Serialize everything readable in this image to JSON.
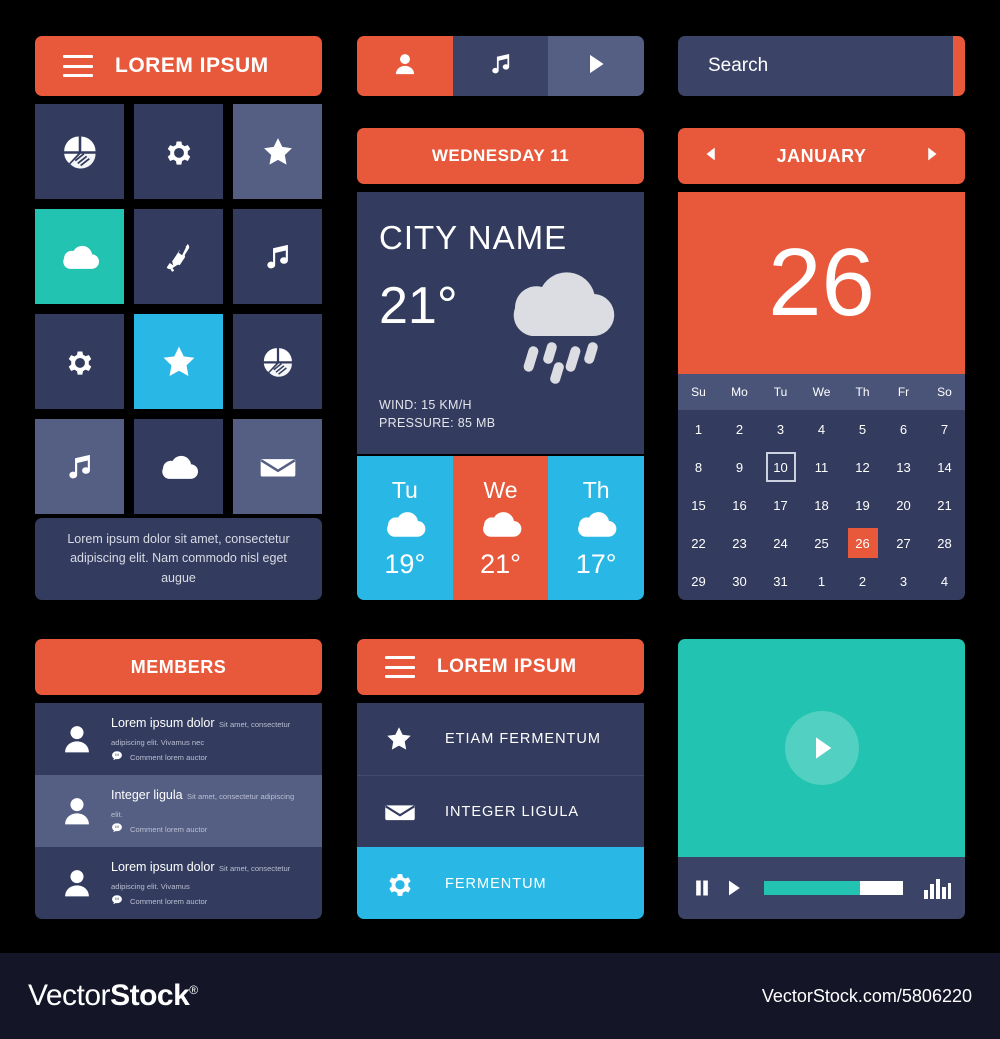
{
  "colors": {
    "background": "#000000",
    "orange": "#e8583a",
    "navy_dark": "#333c5e",
    "navy_mid": "#3b4467",
    "navy_light": "#555f83",
    "teal": "#22c3b0",
    "cyan": "#29b8e5",
    "footer_bg": "#141527",
    "text_white": "#ffffff"
  },
  "app_menu": {
    "header": {
      "title": "LOREM IPSUM",
      "menu_icon": "hamburger-icon"
    },
    "tiles": [
      {
        "icon": "pie-chart-icon",
        "style": "dark"
      },
      {
        "icon": "gear-icon",
        "style": "dark"
      },
      {
        "icon": "star-icon",
        "style": "light"
      },
      {
        "icon": "cloud-icon",
        "style": "teal"
      },
      {
        "icon": "phone-icon",
        "style": "dark"
      },
      {
        "icon": "music-note-icon",
        "style": "dark"
      },
      {
        "icon": "gear-icon",
        "style": "dark"
      },
      {
        "icon": "star-icon",
        "style": "cyan"
      },
      {
        "icon": "pie-chart-icon",
        "style": "dark"
      },
      {
        "icon": "music-note-icon",
        "style": "light"
      },
      {
        "icon": "cloud-icon",
        "style": "dark"
      },
      {
        "icon": "envelope-icon",
        "style": "light"
      }
    ],
    "blurb": "Lorem ipsum dolor sit amet, consectetur adipiscing elit. Nam commodo nisl eget augue"
  },
  "members": {
    "header": "MEMBERS",
    "rows": [
      {
        "avatar": "user-icon",
        "name": "Lorem ipsum dolor",
        "desc": "Sit amet, consectetur adipiscing elit. Vivamus nec",
        "comment_icon": "comment-icon",
        "comment": "Comment lorem auctor",
        "style": "odd"
      },
      {
        "avatar": "user-icon",
        "name": "Integer ligula",
        "desc": "Sit amet, consectetur adipiscing elit.",
        "comment_icon": "comment-icon",
        "comment": "Comment lorem auctor",
        "style": "even"
      },
      {
        "avatar": "user-icon",
        "name": "Lorem ipsum dolor",
        "desc": "Sit amet, consectetur adipiscing elit. Vivamus",
        "comment_icon": "comment-icon",
        "comment": "Comment lorem auctor",
        "style": "odd"
      }
    ]
  },
  "tabbar": {
    "tabs": [
      {
        "icon": "user-icon",
        "state": "active"
      },
      {
        "icon": "music-note-icon",
        "state": "normal"
      },
      {
        "icon": "play-icon",
        "state": "alt"
      }
    ]
  },
  "weather": {
    "header": "WEDNESDAY 11",
    "city": "CITY NAME",
    "temperature": "21°",
    "condition_icon": "rain-cloud-icon",
    "wind": "WIND: 15 KM/H",
    "pressure": "PRESSURE: 85 MB",
    "forecast": [
      {
        "day": "Tu",
        "icon": "cloud-icon",
        "temp": "19°",
        "style": "cyan"
      },
      {
        "day": "We",
        "icon": "cloud-icon",
        "temp": "21°",
        "style": "orange"
      },
      {
        "day": "Th",
        "icon": "cloud-icon",
        "temp": "17°",
        "style": "cyan"
      }
    ]
  },
  "menu_list": {
    "header": {
      "title": "LOREM IPSUM",
      "menu_icon": "hamburger-icon"
    },
    "items": [
      {
        "icon": "star-icon",
        "label": "ETIAM FERMENTUM",
        "selected": false
      },
      {
        "icon": "envelope-icon",
        "label": "INTEGER LIGULA",
        "selected": false
      },
      {
        "icon": "gear-icon",
        "label": "FERMENTUM",
        "selected": true
      }
    ]
  },
  "search": {
    "value": "Search",
    "placeholder": "Search",
    "button_icon": "search-icon"
  },
  "calendar": {
    "month": "JANUARY",
    "prev_icon": "chevron-left-icon",
    "next_icon": "chevron-right-icon",
    "selected_big": "26",
    "dow": [
      "Su",
      "Mo",
      "Tu",
      "We",
      "Th",
      "Fr",
      "So"
    ],
    "days": [
      {
        "n": "1"
      },
      {
        "n": "2"
      },
      {
        "n": "3"
      },
      {
        "n": "4"
      },
      {
        "n": "5"
      },
      {
        "n": "6"
      },
      {
        "n": "7"
      },
      {
        "n": "8"
      },
      {
        "n": "9"
      },
      {
        "n": "10",
        "state": "outlined"
      },
      {
        "n": "11"
      },
      {
        "n": "12"
      },
      {
        "n": "13"
      },
      {
        "n": "14"
      },
      {
        "n": "15"
      },
      {
        "n": "16"
      },
      {
        "n": "17"
      },
      {
        "n": "18"
      },
      {
        "n": "19"
      },
      {
        "n": "20"
      },
      {
        "n": "21"
      },
      {
        "n": "22"
      },
      {
        "n": "23"
      },
      {
        "n": "24"
      },
      {
        "n": "25"
      },
      {
        "n": "26",
        "state": "today"
      },
      {
        "n": "27"
      },
      {
        "n": "28"
      },
      {
        "n": "29"
      },
      {
        "n": "30"
      },
      {
        "n": "31"
      },
      {
        "n": "1"
      },
      {
        "n": "2"
      },
      {
        "n": "3"
      },
      {
        "n": "4"
      }
    ]
  },
  "video": {
    "play_overlay_icon": "play-circle-icon",
    "pause_icon": "pause-icon",
    "play_icon": "play-icon",
    "equalizer_icon": "equalizer-icon",
    "progress_percent": 69
  },
  "footer": {
    "brand_light": "Vector",
    "brand_bold": "Stock",
    "brand_mark": "®",
    "url": "VectorStock.com/5806220"
  }
}
